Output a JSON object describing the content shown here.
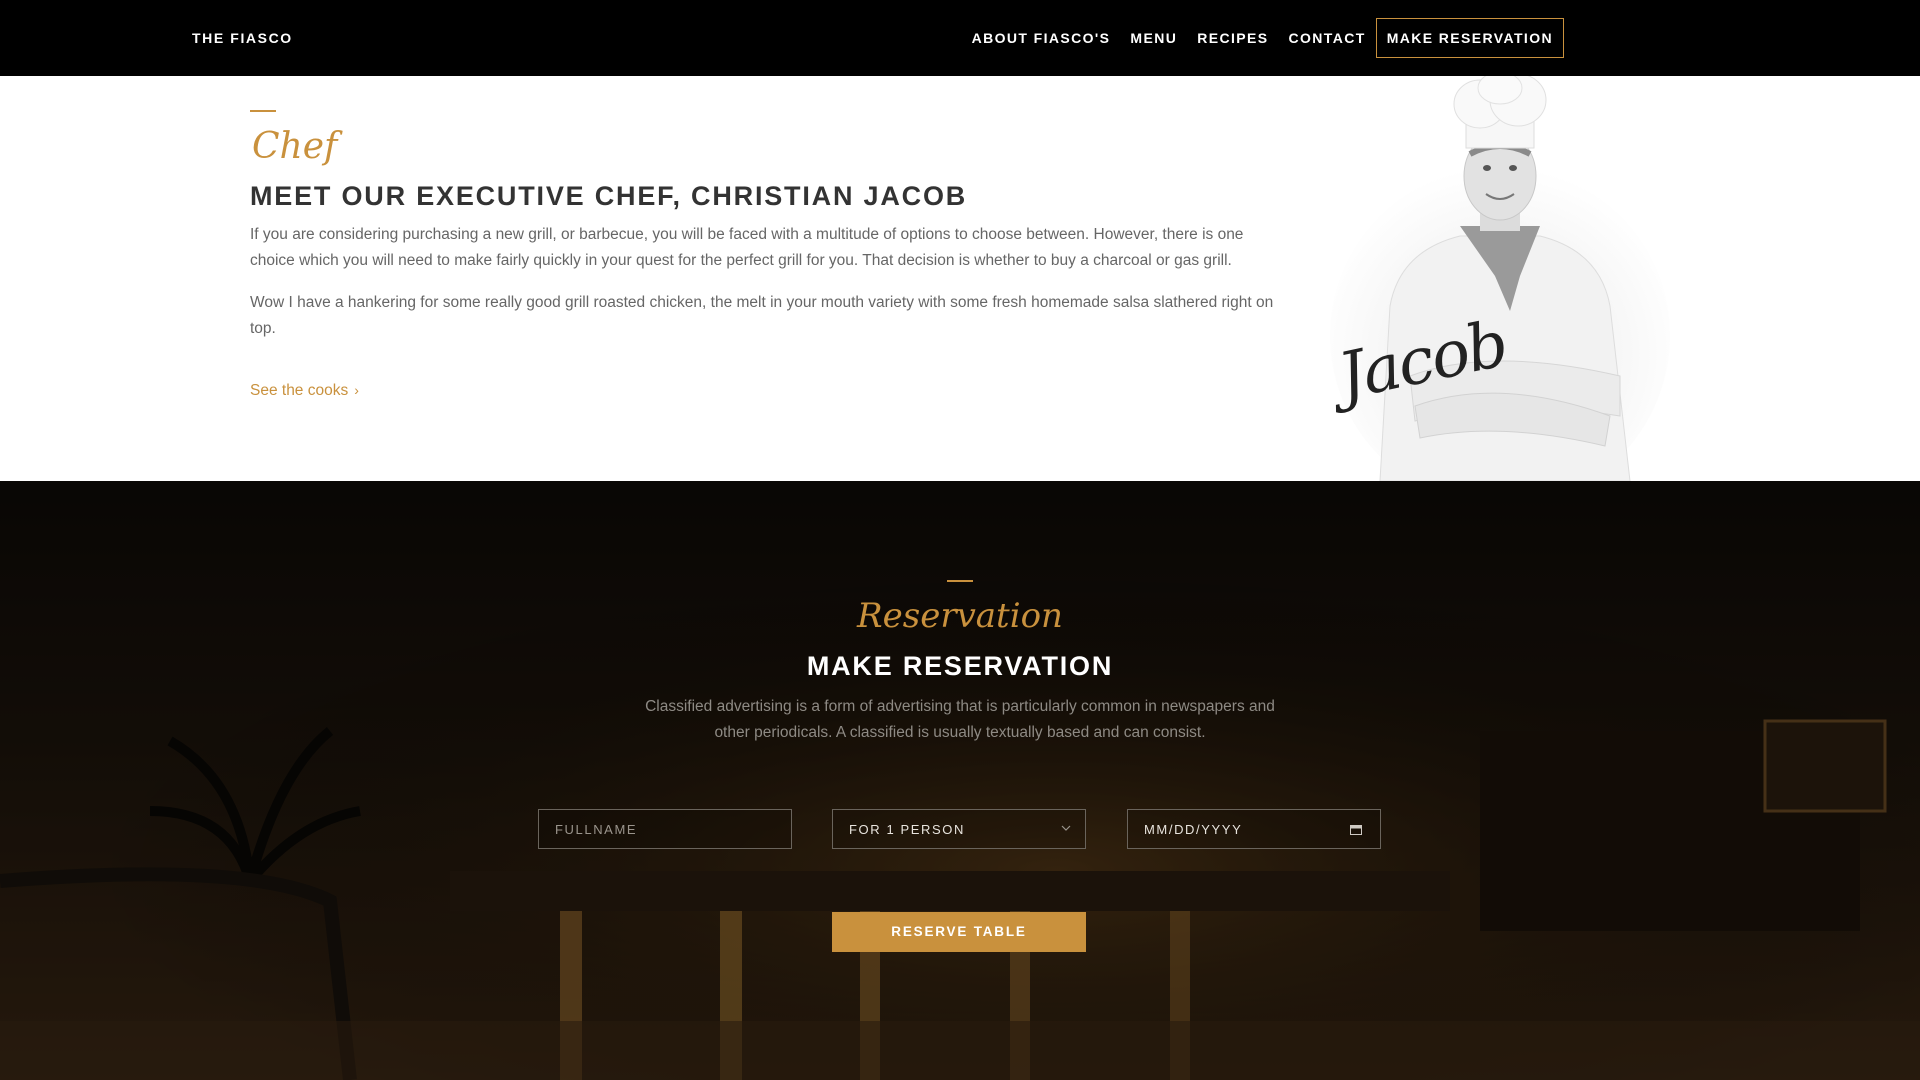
{
  "nav": {
    "brand": "THE FIASCO",
    "links": [
      "ABOUT FIASCO'S",
      "MENU",
      "RECIPES",
      "CONTACT"
    ],
    "cta": "MAKE RESERVATION"
  },
  "chef": {
    "script_title": "Chef",
    "heading": "MEET OUR EXECUTIVE CHEF, CHRISTIAN JACOB",
    "paragraph1": "If you are considering purchasing a new grill, or barbecue, you will be faced with a multitude of options to choose between. However, there is one choice which you will need to make fairly quickly in your quest for the perfect grill for you. That decision is whether to buy a charcoal or gas grill.",
    "paragraph2": "Wow I have a hankering for some really good grill roasted chicken, the melt in your mouth variety with some fresh homemade salsa slathered right on top.",
    "link": "See the cooks",
    "link_icon": "chevron-right-icon",
    "signature": "Jacob"
  },
  "reservation": {
    "script_title": "Reservation",
    "heading": "MAKE RESERVATION",
    "description": "Classified advertising is a form of advertising that is particularly common in newspapers and other periodicals. A classified is usually textually based and can consist.",
    "fullname_placeholder": "FULLNAME",
    "persons_selected": "FOR 1 PERSON",
    "date_placeholder": "MM/DD/YYYY",
    "button": "RESERVE TABLE"
  },
  "colors": {
    "accent": "#c9913d",
    "nav_bg": "#000000",
    "heading": "#333333",
    "body_text": "#666666"
  }
}
